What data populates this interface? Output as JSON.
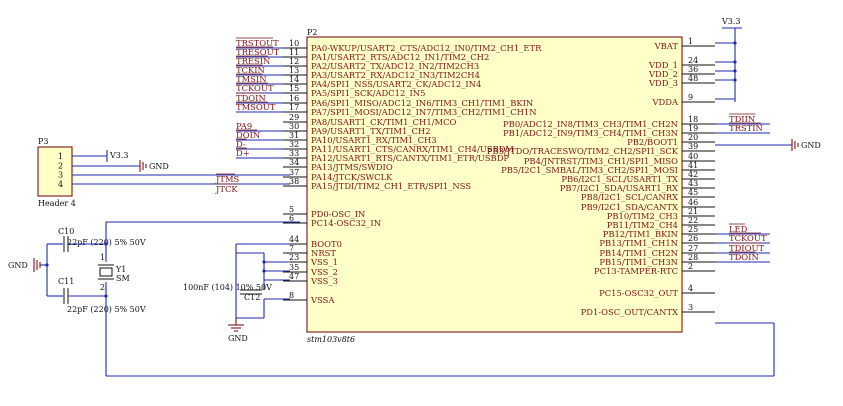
{
  "schematic": {
    "main_ic": {
      "designator": "P2",
      "part_name": "stm103v8t6",
      "left_pins": [
        {
          "num": "10",
          "name": "PA0-WKUP/USART2_CTS/ADC12_IN0/TIM2_CH1_ETR",
          "net": "TRSTOUT",
          "inv": true
        },
        {
          "num": "11",
          "name": "PA1/USART2_RTS/ADC12_IN1/TIM2_CH2",
          "net": "TRESOUT",
          "inv": true
        },
        {
          "num": "12",
          "name": "PA2/USART2_TX/ADC12_IN2/TIM2CH3",
          "net": "TRESIN",
          "inv": true
        },
        {
          "num": "13",
          "name": "PA3/USART2_RX/ADC12_IN3/TIM2CH4",
          "net": "TCKIN",
          "inv": true
        },
        {
          "num": "14",
          "name": "PA4/SPI1_NSS/USART2_CK/ADC12_IN4",
          "net": "TMSIN",
          "inv": true
        },
        {
          "num": "15",
          "name": "PA5/SPI1_SCK/ADC12_IN5",
          "net": "TCKOUT",
          "inv": true
        },
        {
          "num": "16",
          "name": "PA6/SPI1_MISO/ADC12_IN6/TIM3_CH1/TIM1_BKIN",
          "net": "TDOIN",
          "inv": true
        },
        {
          "num": "17",
          "name": "PA7/SPI1_MOSI/ADC12_IN7/TIM3_CH2/TIM1_CH1N",
          "net": "TMSOUT",
          "inv": true
        },
        {
          "num": "29",
          "name": "PA8/USART1_CK/TIM1_CH1/MCO",
          "net": "",
          "inv": false
        },
        {
          "num": "30",
          "name": "PA9/USART1_TX/TIM1_CH2",
          "net": "PA9",
          "inv": false
        },
        {
          "num": "31",
          "name": "PA10/USART1_RX/TIM1_CH3",
          "net": "DOIN",
          "inv": true
        },
        {
          "num": "32",
          "name": "PA11/USART1_CTS/CANRX/TIM1_CH4/USBDM",
          "net": "D-",
          "inv": true
        },
        {
          "num": "33",
          "name": "PA12/USART1_RTS/CANTX/TIM1_ETR/USBDP",
          "net": "D+",
          "inv": true
        },
        {
          "num": "34",
          "name": "PA13/JTMS/SWDIO",
          "net": "",
          "inv": false
        },
        {
          "num": "37",
          "name": "PA14/JTCK/SWCLK",
          "net": "",
          "inv": false
        },
        {
          "num": "38",
          "name": "PA15/JTDI/TIM2_CH1_ETR/SPI1_NSS",
          "net": "",
          "inv": false
        },
        {
          "num": "5",
          "name": "PD0-OSC_IN",
          "net": "",
          "inv": false
        },
        {
          "num": "6",
          "name": "PC14-OSC32_IN",
          "net": "",
          "inv": false
        },
        {
          "num": "44",
          "name": "BOOT0",
          "net": "",
          "inv": false
        },
        {
          "num": "7",
          "name": "NRST",
          "net": "",
          "inv": false
        },
        {
          "num": "23",
          "name": "VSS_1",
          "net": "",
          "inv": false
        },
        {
          "num": "35",
          "name": "VSS_2",
          "net": "",
          "inv": false
        },
        {
          "num": "47",
          "name": "VSS_3",
          "net": "",
          "inv": false
        },
        {
          "num": "8",
          "name": "VSSA",
          "net": "",
          "inv": false
        }
      ],
      "right_pins": [
        {
          "num": "1",
          "name": "VBAT",
          "net": ""
        },
        {
          "num": "24",
          "name": "VDD_1",
          "net": ""
        },
        {
          "num": "36",
          "name": "VDD_2",
          "net": ""
        },
        {
          "num": "48",
          "name": "VDD_3",
          "net": ""
        },
        {
          "num": "9",
          "name": "VDDA",
          "net": ""
        },
        {
          "num": "18",
          "name": "PB0/ADC12_IN8/TIM3_CH3/TIM1_CH2N",
          "net": "TDIIN"
        },
        {
          "num": "19",
          "name": "PB1/ADC12_IN9/TIM3_CH4/TIM1_CH3N",
          "net": "TRSTIN"
        },
        {
          "num": "20",
          "name": "PB2/BOOT1",
          "net": ""
        },
        {
          "num": "39",
          "name": "PB3/JTDO/TRACESWO/TIM2_CH2/SPI1_SCK",
          "net": ""
        },
        {
          "num": "40",
          "name": "PB4/JNTRST/TIM3_CH1/SPI1_MISO",
          "net": ""
        },
        {
          "num": "41",
          "name": "PB5/I2C1_SMBAL/TIM3_CH2/SPI1_MOSI",
          "net": ""
        },
        {
          "num": "42",
          "name": "PB6/I2C1_SCL/USART1_TX",
          "net": ""
        },
        {
          "num": "43",
          "name": "PB7/I2C1_SDA/USART1_RX",
          "net": ""
        },
        {
          "num": "45",
          "name": "PB8/I2C1_SCL/CANRX",
          "net": ""
        },
        {
          "num": "46",
          "name": "PB9/I2C1_SDA/CANTX",
          "net": ""
        },
        {
          "num": "21",
          "name": "PB10/TIM2_CH3",
          "net": ""
        },
        {
          "num": "22",
          "name": "PB11/TIM2_CH4",
          "net": ""
        },
        {
          "num": "25",
          "name": "PB12/TIM1_BKIN",
          "net": "LED"
        },
        {
          "num": "26",
          "name": "PB13/TIM1_CH1N",
          "net": "TCKOUT"
        },
        {
          "num": "27",
          "name": "PB14/TIM1_CH2N",
          "net": "TDIOUT"
        },
        {
          "num": "28",
          "name": "PB15/TIM1_CH3N",
          "net": "TDOIN"
        },
        {
          "num": "2",
          "name": "PC13-TAMPER-RTC",
          "net": ""
        },
        {
          "num": "4",
          "name": "PC15-OSC32_OUT",
          "net": ""
        },
        {
          "num": "3",
          "name": "PD1-OSC_OUT/CANTX",
          "net": ""
        }
      ],
      "extra_left_nets": {
        "pa13": "JTMS",
        "pa14": "JTCK"
      }
    },
    "header": {
      "designator": "P3",
      "name": "Header 4",
      "pins": [
        "1",
        "2",
        "3",
        "4"
      ],
      "power_label": "V3.3",
      "gnd_label": "GND"
    },
    "power": {
      "vcc_label": "V3.3",
      "gnd_label": "GND"
    },
    "crystal": {
      "designator": "Y1",
      "value": "SM",
      "pin1": "1",
      "pin2": "2"
    },
    "c10": {
      "designator": "C10",
      "value": "22pF (220) 5% 50V"
    },
    "c11": {
      "designator": "C11",
      "value": "22pF (220) 5% 50V"
    },
    "c12": {
      "designator": "C12",
      "value": "100nF (104) 10% 50V"
    },
    "gnd_left": "GND",
    "gnd_bottom": "GND"
  }
}
